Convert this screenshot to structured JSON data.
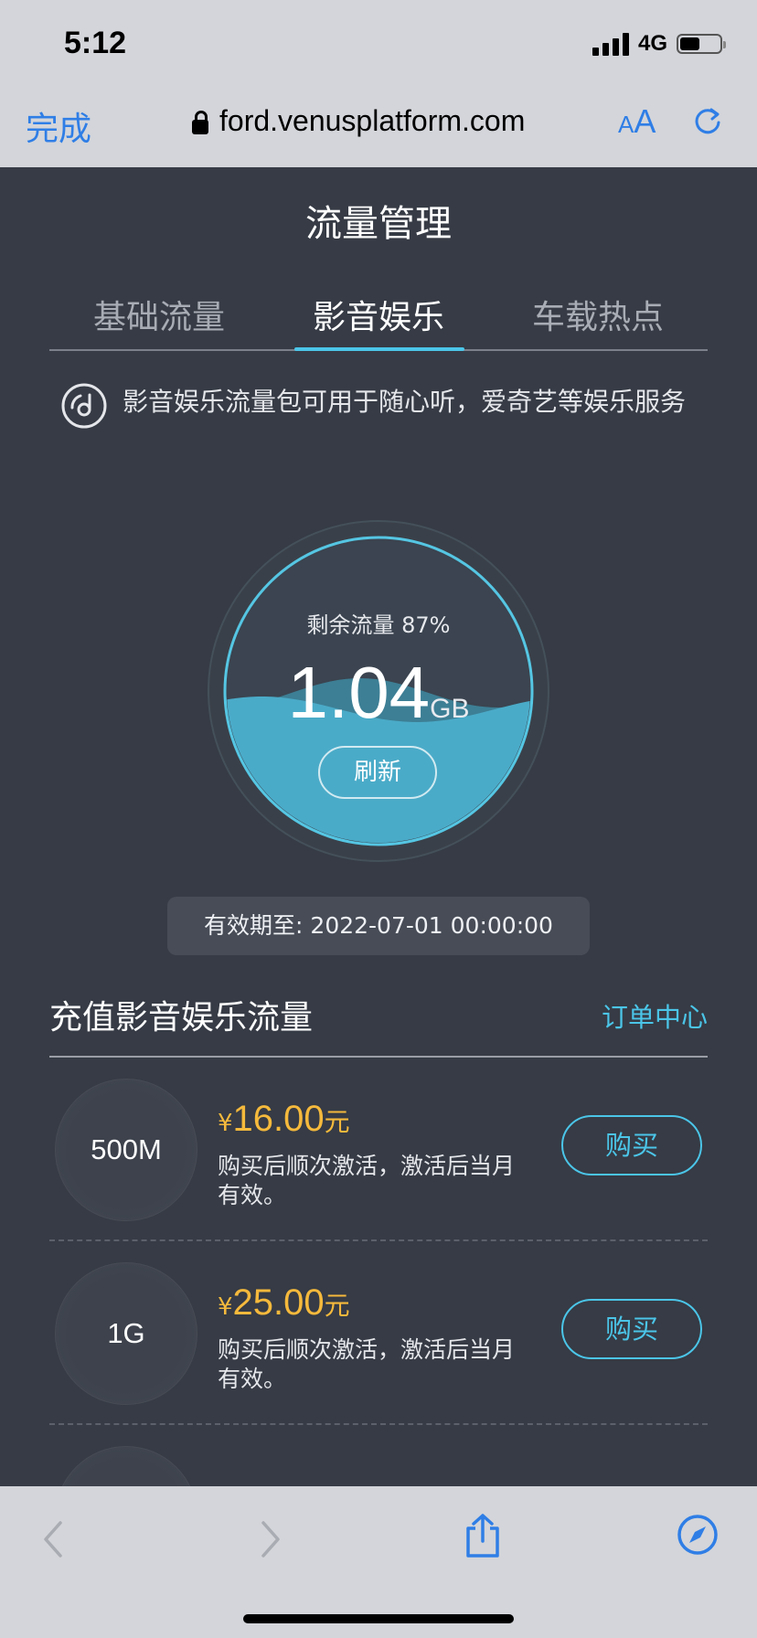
{
  "status_bar": {
    "time": "5:12",
    "network": "4G",
    "battery_level": 0.5
  },
  "browser": {
    "done_label": "完成",
    "url": "ford.venusplatform.com",
    "text_size_small": "A",
    "text_size_big": "A"
  },
  "page": {
    "title": "流量管理",
    "tabs": [
      {
        "label": "基础流量",
        "active": false
      },
      {
        "label": "影音娱乐",
        "active": true
      },
      {
        "label": "车载热点",
        "active": false
      }
    ],
    "info_text": "影音娱乐流量包可用于随心听，爱奇艺等娱乐服务",
    "gauge": {
      "label": "剩余流量 87%",
      "remaining_percent": 87,
      "value": "1.04",
      "unit": "GB",
      "refresh_label": "刷新"
    },
    "expiry": "有效期至: 2022-07-01 00:00:00",
    "recharge": {
      "title": "充值影音娱乐流量",
      "order_link": "订单中心",
      "packages": [
        {
          "size": "500M",
          "currency": "¥",
          "price": "16.00",
          "price_unit": "元",
          "desc": "购买后顺次激活，激活后当月有效。",
          "buy_label": "购买"
        },
        {
          "size": "1G",
          "currency": "¥",
          "price": "25.00",
          "price_unit": "元",
          "desc": "购买后顺次激活，激活后当月有效。",
          "buy_label": "购买"
        }
      ]
    }
  },
  "colors": {
    "accent": "#4bc5e8",
    "price": "#f5b93c",
    "background": "#363b45",
    "browser_blue": "#2f7ee6"
  }
}
